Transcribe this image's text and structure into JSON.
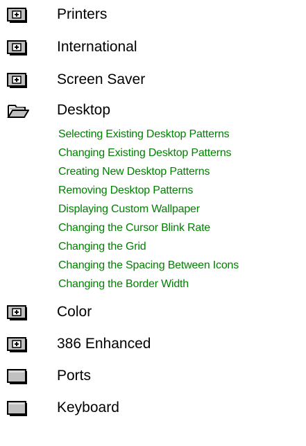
{
  "tree": {
    "nodes": [
      {
        "label": "Printers",
        "icon": "closed-book-plus-icon"
      },
      {
        "label": "International",
        "icon": "closed-book-plus-icon"
      },
      {
        "label": "Screen Saver",
        "icon": "closed-book-plus-icon"
      },
      {
        "label": "Desktop",
        "icon": "open-book-icon"
      },
      {
        "label": "Color",
        "icon": "closed-book-plus-icon"
      },
      {
        "label": "386 Enhanced",
        "icon": "closed-book-plus-icon"
      },
      {
        "label": "Ports",
        "icon": "closed-book-icon"
      },
      {
        "label": "Keyboard",
        "icon": "closed-book-icon"
      }
    ],
    "desktop_topics": [
      "Selecting Existing Desktop Patterns",
      "Changing Existing Desktop Patterns",
      "Creating New Desktop Patterns",
      "Removing Desktop Patterns",
      "Displaying Custom Wallpaper",
      "Changing the Cursor Blink Rate",
      "Changing the Grid",
      "Changing the Spacing Between Icons",
      "Changing the Border Width"
    ]
  },
  "colors": {
    "topic_link": "#008000",
    "book_fill": "#c0c0c0",
    "book_outline": "#000000"
  }
}
